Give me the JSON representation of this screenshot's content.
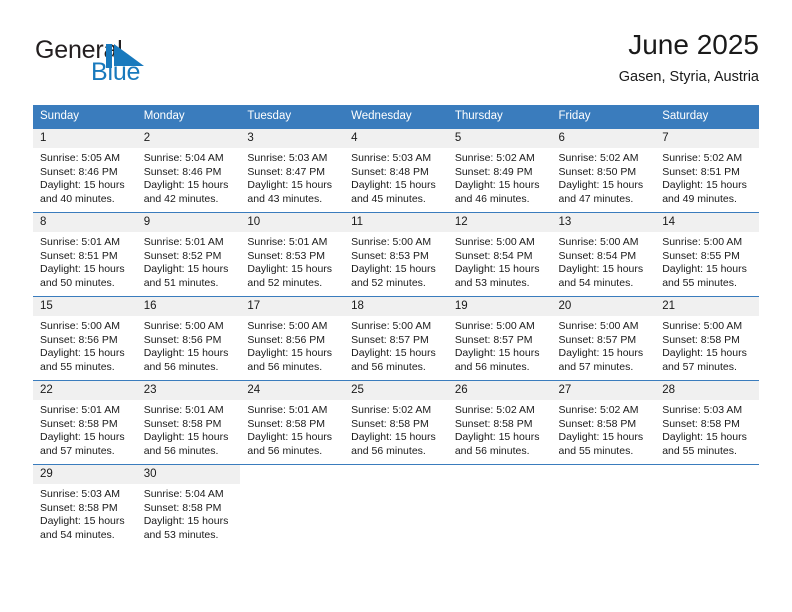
{
  "brand": {
    "name_part1": "General",
    "name_part2": "Blue",
    "flag_color": "#1879bd",
    "text_color": "#231f20"
  },
  "header": {
    "title": "June 2025",
    "location": "Gasen, Styria, Austria"
  },
  "theme": {
    "header_blue": "#3a7cbd",
    "daynum_bg": "#f0f0f0",
    "text": "#1a1a1a"
  },
  "weekdays": [
    "Sunday",
    "Monday",
    "Tuesday",
    "Wednesday",
    "Thursday",
    "Friday",
    "Saturday"
  ],
  "weeks": [
    {
      "days": [
        {
          "num": "1",
          "sunrise": "Sunrise: 5:05 AM",
          "sunset": "Sunset: 8:46 PM",
          "daylight1": "Daylight: 15 hours",
          "daylight2": "and 40 minutes."
        },
        {
          "num": "2",
          "sunrise": "Sunrise: 5:04 AM",
          "sunset": "Sunset: 8:46 PM",
          "daylight1": "Daylight: 15 hours",
          "daylight2": "and 42 minutes."
        },
        {
          "num": "3",
          "sunrise": "Sunrise: 5:03 AM",
          "sunset": "Sunset: 8:47 PM",
          "daylight1": "Daylight: 15 hours",
          "daylight2": "and 43 minutes."
        },
        {
          "num": "4",
          "sunrise": "Sunrise: 5:03 AM",
          "sunset": "Sunset: 8:48 PM",
          "daylight1": "Daylight: 15 hours",
          "daylight2": "and 45 minutes."
        },
        {
          "num": "5",
          "sunrise": "Sunrise: 5:02 AM",
          "sunset": "Sunset: 8:49 PM",
          "daylight1": "Daylight: 15 hours",
          "daylight2": "and 46 minutes."
        },
        {
          "num": "6",
          "sunrise": "Sunrise: 5:02 AM",
          "sunset": "Sunset: 8:50 PM",
          "daylight1": "Daylight: 15 hours",
          "daylight2": "and 47 minutes."
        },
        {
          "num": "7",
          "sunrise": "Sunrise: 5:02 AM",
          "sunset": "Sunset: 8:51 PM",
          "daylight1": "Daylight: 15 hours",
          "daylight2": "and 49 minutes."
        }
      ]
    },
    {
      "days": [
        {
          "num": "8",
          "sunrise": "Sunrise: 5:01 AM",
          "sunset": "Sunset: 8:51 PM",
          "daylight1": "Daylight: 15 hours",
          "daylight2": "and 50 minutes."
        },
        {
          "num": "9",
          "sunrise": "Sunrise: 5:01 AM",
          "sunset": "Sunset: 8:52 PM",
          "daylight1": "Daylight: 15 hours",
          "daylight2": "and 51 minutes."
        },
        {
          "num": "10",
          "sunrise": "Sunrise: 5:01 AM",
          "sunset": "Sunset: 8:53 PM",
          "daylight1": "Daylight: 15 hours",
          "daylight2": "and 52 minutes."
        },
        {
          "num": "11",
          "sunrise": "Sunrise: 5:00 AM",
          "sunset": "Sunset: 8:53 PM",
          "daylight1": "Daylight: 15 hours",
          "daylight2": "and 52 minutes."
        },
        {
          "num": "12",
          "sunrise": "Sunrise: 5:00 AM",
          "sunset": "Sunset: 8:54 PM",
          "daylight1": "Daylight: 15 hours",
          "daylight2": "and 53 minutes."
        },
        {
          "num": "13",
          "sunrise": "Sunrise: 5:00 AM",
          "sunset": "Sunset: 8:54 PM",
          "daylight1": "Daylight: 15 hours",
          "daylight2": "and 54 minutes."
        },
        {
          "num": "14",
          "sunrise": "Sunrise: 5:00 AM",
          "sunset": "Sunset: 8:55 PM",
          "daylight1": "Daylight: 15 hours",
          "daylight2": "and 55 minutes."
        }
      ]
    },
    {
      "days": [
        {
          "num": "15",
          "sunrise": "Sunrise: 5:00 AM",
          "sunset": "Sunset: 8:56 PM",
          "daylight1": "Daylight: 15 hours",
          "daylight2": "and 55 minutes."
        },
        {
          "num": "16",
          "sunrise": "Sunrise: 5:00 AM",
          "sunset": "Sunset: 8:56 PM",
          "daylight1": "Daylight: 15 hours",
          "daylight2": "and 56 minutes."
        },
        {
          "num": "17",
          "sunrise": "Sunrise: 5:00 AM",
          "sunset": "Sunset: 8:56 PM",
          "daylight1": "Daylight: 15 hours",
          "daylight2": "and 56 minutes."
        },
        {
          "num": "18",
          "sunrise": "Sunrise: 5:00 AM",
          "sunset": "Sunset: 8:57 PM",
          "daylight1": "Daylight: 15 hours",
          "daylight2": "and 56 minutes."
        },
        {
          "num": "19",
          "sunrise": "Sunrise: 5:00 AM",
          "sunset": "Sunset: 8:57 PM",
          "daylight1": "Daylight: 15 hours",
          "daylight2": "and 56 minutes."
        },
        {
          "num": "20",
          "sunrise": "Sunrise: 5:00 AM",
          "sunset": "Sunset: 8:57 PM",
          "daylight1": "Daylight: 15 hours",
          "daylight2": "and 57 minutes."
        },
        {
          "num": "21",
          "sunrise": "Sunrise: 5:00 AM",
          "sunset": "Sunset: 8:58 PM",
          "daylight1": "Daylight: 15 hours",
          "daylight2": "and 57 minutes."
        }
      ]
    },
    {
      "days": [
        {
          "num": "22",
          "sunrise": "Sunrise: 5:01 AM",
          "sunset": "Sunset: 8:58 PM",
          "daylight1": "Daylight: 15 hours",
          "daylight2": "and 57 minutes."
        },
        {
          "num": "23",
          "sunrise": "Sunrise: 5:01 AM",
          "sunset": "Sunset: 8:58 PM",
          "daylight1": "Daylight: 15 hours",
          "daylight2": "and 56 minutes."
        },
        {
          "num": "24",
          "sunrise": "Sunrise: 5:01 AM",
          "sunset": "Sunset: 8:58 PM",
          "daylight1": "Daylight: 15 hours",
          "daylight2": "and 56 minutes."
        },
        {
          "num": "25",
          "sunrise": "Sunrise: 5:02 AM",
          "sunset": "Sunset: 8:58 PM",
          "daylight1": "Daylight: 15 hours",
          "daylight2": "and 56 minutes."
        },
        {
          "num": "26",
          "sunrise": "Sunrise: 5:02 AM",
          "sunset": "Sunset: 8:58 PM",
          "daylight1": "Daylight: 15 hours",
          "daylight2": "and 56 minutes."
        },
        {
          "num": "27",
          "sunrise": "Sunrise: 5:02 AM",
          "sunset": "Sunset: 8:58 PM",
          "daylight1": "Daylight: 15 hours",
          "daylight2": "and 55 minutes."
        },
        {
          "num": "28",
          "sunrise": "Sunrise: 5:03 AM",
          "sunset": "Sunset: 8:58 PM",
          "daylight1": "Daylight: 15 hours",
          "daylight2": "and 55 minutes."
        }
      ]
    },
    {
      "days": [
        {
          "num": "29",
          "sunrise": "Sunrise: 5:03 AM",
          "sunset": "Sunset: 8:58 PM",
          "daylight1": "Daylight: 15 hours",
          "daylight2": "and 54 minutes."
        },
        {
          "num": "30",
          "sunrise": "Sunrise: 5:04 AM",
          "sunset": "Sunset: 8:58 PM",
          "daylight1": "Daylight: 15 hours",
          "daylight2": "and 53 minutes."
        },
        {
          "num": "",
          "sunrise": "",
          "sunset": "",
          "daylight1": "",
          "daylight2": ""
        },
        {
          "num": "",
          "sunrise": "",
          "sunset": "",
          "daylight1": "",
          "daylight2": ""
        },
        {
          "num": "",
          "sunrise": "",
          "sunset": "",
          "daylight1": "",
          "daylight2": ""
        },
        {
          "num": "",
          "sunrise": "",
          "sunset": "",
          "daylight1": "",
          "daylight2": ""
        },
        {
          "num": "",
          "sunrise": "",
          "sunset": "",
          "daylight1": "",
          "daylight2": ""
        }
      ]
    }
  ]
}
